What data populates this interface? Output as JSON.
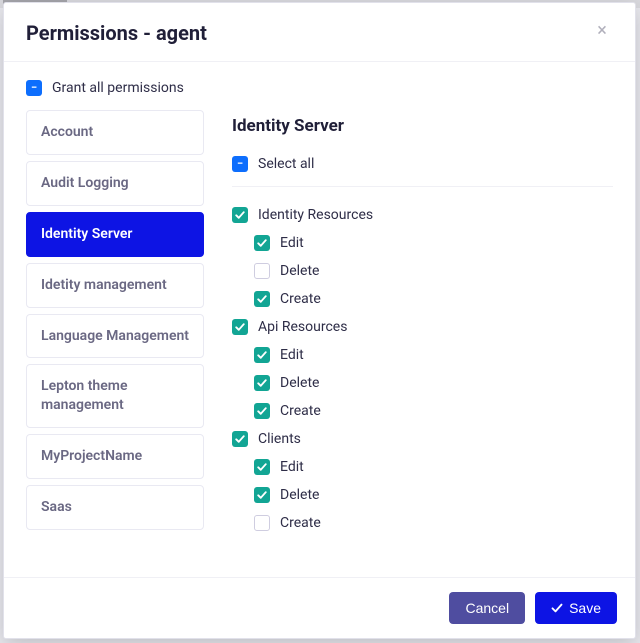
{
  "modal": {
    "title": "Permissions - agent",
    "close_glyph": "×"
  },
  "grant_all": {
    "label": "Grant all permissions",
    "state": "indeterminate",
    "glyph": "−"
  },
  "categories": [
    {
      "label": "Account",
      "active": false
    },
    {
      "label": "Audit Logging",
      "active": false
    },
    {
      "label": "Identity Server",
      "active": true
    },
    {
      "label": "Idetity management",
      "active": false
    },
    {
      "label": "Language Management",
      "active": false
    },
    {
      "label": "Lepton theme management",
      "active": false
    },
    {
      "label": "MyProjectName",
      "active": false
    },
    {
      "label": "Saas",
      "active": false
    }
  ],
  "detail": {
    "title": "Identity Server",
    "select_all": {
      "label": "Select all",
      "state": "indeterminate",
      "glyph": "−"
    },
    "tree": [
      {
        "label": "Identity Resources",
        "level": 1,
        "state": "checked"
      },
      {
        "label": "Edit",
        "level": 2,
        "state": "checked"
      },
      {
        "label": "Delete",
        "level": 2,
        "state": "unchecked"
      },
      {
        "label": "Create",
        "level": 2,
        "state": "checked"
      },
      {
        "label": "Api Resources",
        "level": 1,
        "state": "checked"
      },
      {
        "label": "Edit",
        "level": 2,
        "state": "checked"
      },
      {
        "label": "Delete",
        "level": 2,
        "state": "checked"
      },
      {
        "label": "Create",
        "level": 2,
        "state": "checked"
      },
      {
        "label": "Clients",
        "level": 1,
        "state": "checked"
      },
      {
        "label": "Edit",
        "level": 2,
        "state": "checked"
      },
      {
        "label": "Delete",
        "level": 2,
        "state": "checked"
      },
      {
        "label": "Create",
        "level": 2,
        "state": "unchecked"
      }
    ]
  },
  "footer": {
    "cancel": "Cancel",
    "save": "Save"
  }
}
